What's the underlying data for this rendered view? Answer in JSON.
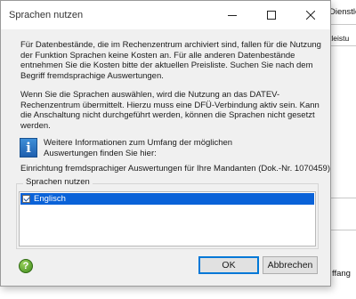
{
  "background": {
    "fragment_1": "Dienstle",
    "fragment_2": "tleistu",
    "fragment_3": "ffang"
  },
  "dialog": {
    "title": "Sprachen nutzen",
    "paragraph_1": "Für Datenbestände, die im Rechenzentrum archiviert sind, fallen für die Nutzung der Funktion Sprachen keine Kosten an. Für alle anderen Datenbestände entnehmen Sie die Kosten bitte der aktuellen Preisliste. Suchen Sie nach dem Begriff  fremdsprachige Auswertungen.",
    "paragraph_2": "Wenn Sie die Sprachen auswählen, wird die Nutzung an das DATEV-Rechenzentrum übermittelt. Hierzu muss eine DFÜ-Verbindung aktiv sein. Kann die Anschaltung nicht durchgeführt werden, können die Sprachen nicht gesetzt werden.",
    "info_icon_glyph": "i",
    "info_line_1": "Weitere Informationen zum Umfang der möglichen",
    "info_line_2": "Auswertungen finden Sie hier:",
    "link_text": "Einrichtung fremdsprachiger Auswertungen für Ihre Mandanten (Dok.-Nr. 1070459)",
    "group_label": "Sprachen nutzen",
    "languages": [
      {
        "label": "Englisch",
        "checked": true,
        "selected": true
      }
    ],
    "help_glyph": "?",
    "ok_label": "OK",
    "cancel_label": "Abbrechen"
  },
  "colors": {
    "selection": "#0a62d8",
    "dialog_bg": "#f0f0f0",
    "default_button_border": "#0078d7"
  }
}
